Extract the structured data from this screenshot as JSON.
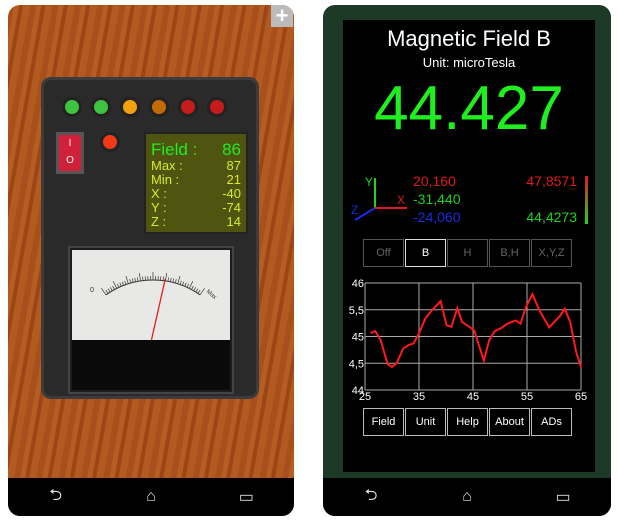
{
  "left_app": {
    "leds": [
      "#3ec43e",
      "#3ec43e",
      "#f2a20f",
      "#c46a06",
      "#c61b1b",
      "#c61b1b"
    ],
    "switch_on": "I",
    "switch_off": "O",
    "lcd": [
      {
        "label": "Field :",
        "value": "86"
      },
      {
        "label": "Max :",
        "value": "87"
      },
      {
        "label": "Min :",
        "value": "21"
      },
      {
        "label": "X :",
        "value": "-40"
      },
      {
        "label": "Y :",
        "value": "-74"
      },
      {
        "label": "Z :",
        "value": "14"
      }
    ],
    "meter": {
      "min_label": "0",
      "max_label": "Max",
      "needle_fraction": 0.62
    }
  },
  "right_app": {
    "title": "Magnetic Field B",
    "unit": "Unit: microTesla",
    "value": "44.427",
    "axes": {
      "y": "Y",
      "x": "X",
      "z": "Z"
    },
    "components": {
      "x": "20,160",
      "y": "-31,440",
      "z": "-24,060"
    },
    "max": "47,8571",
    "min": "44,4273",
    "modes": [
      {
        "label": "Off",
        "active": false
      },
      {
        "label": "B",
        "active": true
      },
      {
        "label": "H",
        "active": false
      },
      {
        "label": "B,H",
        "active": false
      },
      {
        "label": "X,Y,Z",
        "active": false
      }
    ],
    "buttons": [
      "Field",
      "Unit",
      "Help",
      "About",
      "ADs"
    ]
  },
  "chart_data": {
    "type": "line",
    "xlim": [
      25,
      65
    ],
    "ylim": [
      44,
      46
    ],
    "grid": true,
    "xticks": [
      "25",
      "35",
      "45",
      "55",
      "65"
    ],
    "yticks": [
      "44",
      "4,5",
      "45",
      "5,5",
      "46"
    ],
    "color": "#ff1a1a",
    "x": [
      26.1,
      26.9,
      27.9,
      29.2,
      30,
      30.9,
      32.1,
      33.1,
      34,
      35,
      36.2,
      37.4,
      39,
      40.1,
      41,
      42.1,
      43,
      45.2,
      47,
      48,
      49,
      50.1,
      51.4,
      52.9,
      53.8,
      54.8,
      56,
      57.3,
      59.1,
      61,
      62,
      63,
      64.1,
      65
    ],
    "y": [
      45.07,
      45.1,
      44.93,
      44.48,
      44.43,
      44.51,
      44.78,
      44.84,
      44.87,
      45.06,
      45.34,
      45.49,
      45.66,
      45.21,
      45.18,
      45.53,
      45.27,
      45.12,
      44.55,
      44.93,
      45.1,
      45.15,
      45.24,
      45.3,
      45.24,
      45.55,
      45.79,
      45.49,
      45.17,
      45.37,
      45.52,
      45.27,
      44.71,
      44.43
    ]
  },
  "nav": {
    "back": "⮌",
    "home": "⌂",
    "recent": "▭"
  },
  "plus_icon": "+"
}
